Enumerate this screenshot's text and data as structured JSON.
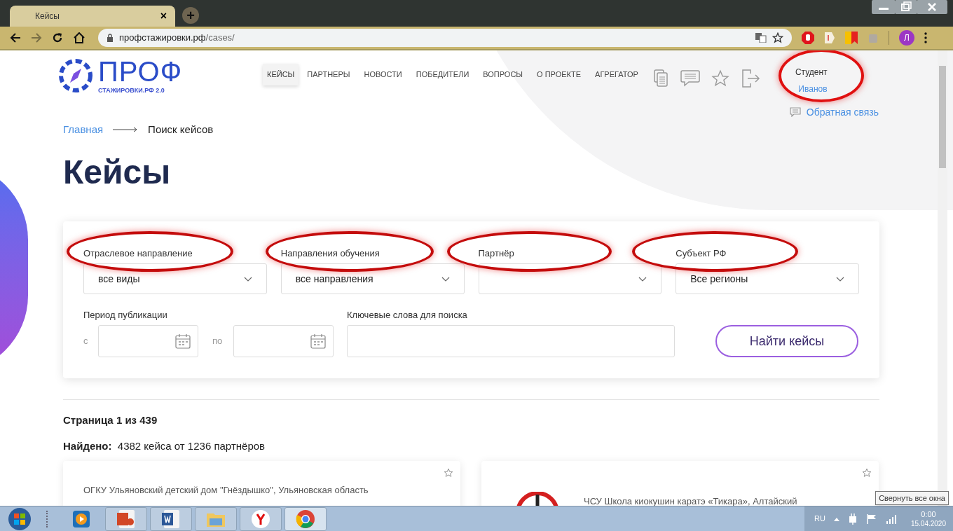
{
  "browser": {
    "tab": {
      "title": "Кейсы",
      "close": "×"
    },
    "new_tab": "+",
    "url": {
      "host": "профстажировки.рф",
      "path": "/cases/"
    },
    "profile_initial": "Л"
  },
  "site": {
    "logo": {
      "title": "ПРОФ",
      "subtitle": "СТАЖИРОВКИ.РФ 2.0"
    },
    "nav": [
      {
        "label": "КЕЙСЫ",
        "selected": true
      },
      {
        "label": "ПАРТНЕРЫ",
        "selected": false
      },
      {
        "label": "НОВОСТИ",
        "selected": false
      },
      {
        "label": "ПОБЕДИТЕЛИ",
        "selected": false
      },
      {
        "label": "ВОПРОСЫ",
        "selected": false
      },
      {
        "label": "О ПРОЕКТЕ",
        "selected": false
      },
      {
        "label": "АГРЕГАТОР",
        "selected": false
      }
    ],
    "user": {
      "role": "Студент",
      "name": "Иванов",
      "highlighted": true
    },
    "feedback": "Обратная связь"
  },
  "breadcrumb": [
    {
      "label": "Главная",
      "kind": "link"
    },
    {
      "label": "Поиск кейсов",
      "kind": "current"
    }
  ],
  "page_title": "Кейсы",
  "filters": {
    "selects": [
      {
        "label": "Отраслевое направление",
        "value": "все виды",
        "highlighted": true
      },
      {
        "label": "Направления обучения",
        "value": "все направления",
        "highlighted": true
      },
      {
        "label": "Партнёр",
        "highlighted": true
      },
      {
        "label": "Субъект РФ",
        "value": "Все регионы",
        "highlighted": true
      }
    ],
    "period": {
      "label": "Период публикации",
      "from_label": "с",
      "to_label": "по"
    },
    "keywords": {
      "label": "Ключевые слова для поиска"
    },
    "submit": "Найти кейсы"
  },
  "results": {
    "page_info": "Страница 1 из 439",
    "found": "**Найдено:**  4382 кейса от 1236 партнёров"
  },
  "cards": [
    {
      "title": "ОГКУ Ульяновский детский дом \"Гнёздышко\", Ульяновская область",
      "has_logo": false
    },
    {
      "title": "ЧСУ Школа киокушин каратэ «Тикара», Алтайский",
      "has_logo": true
    }
  ],
  "taskbar": {
    "apps": [
      {
        "kind": "media",
        "active": false
      },
      {
        "kind": "slides",
        "active": false
      },
      {
        "kind": "word",
        "active": false
      },
      {
        "kind": "folder",
        "active": false
      },
      {
        "kind": "yandex",
        "active": false
      },
      {
        "kind": "chrome",
        "active": true
      }
    ],
    "language": "RU",
    "time": "0:00",
    "date": "15.04.2020",
    "tooltip": "Свернуть все окна"
  }
}
